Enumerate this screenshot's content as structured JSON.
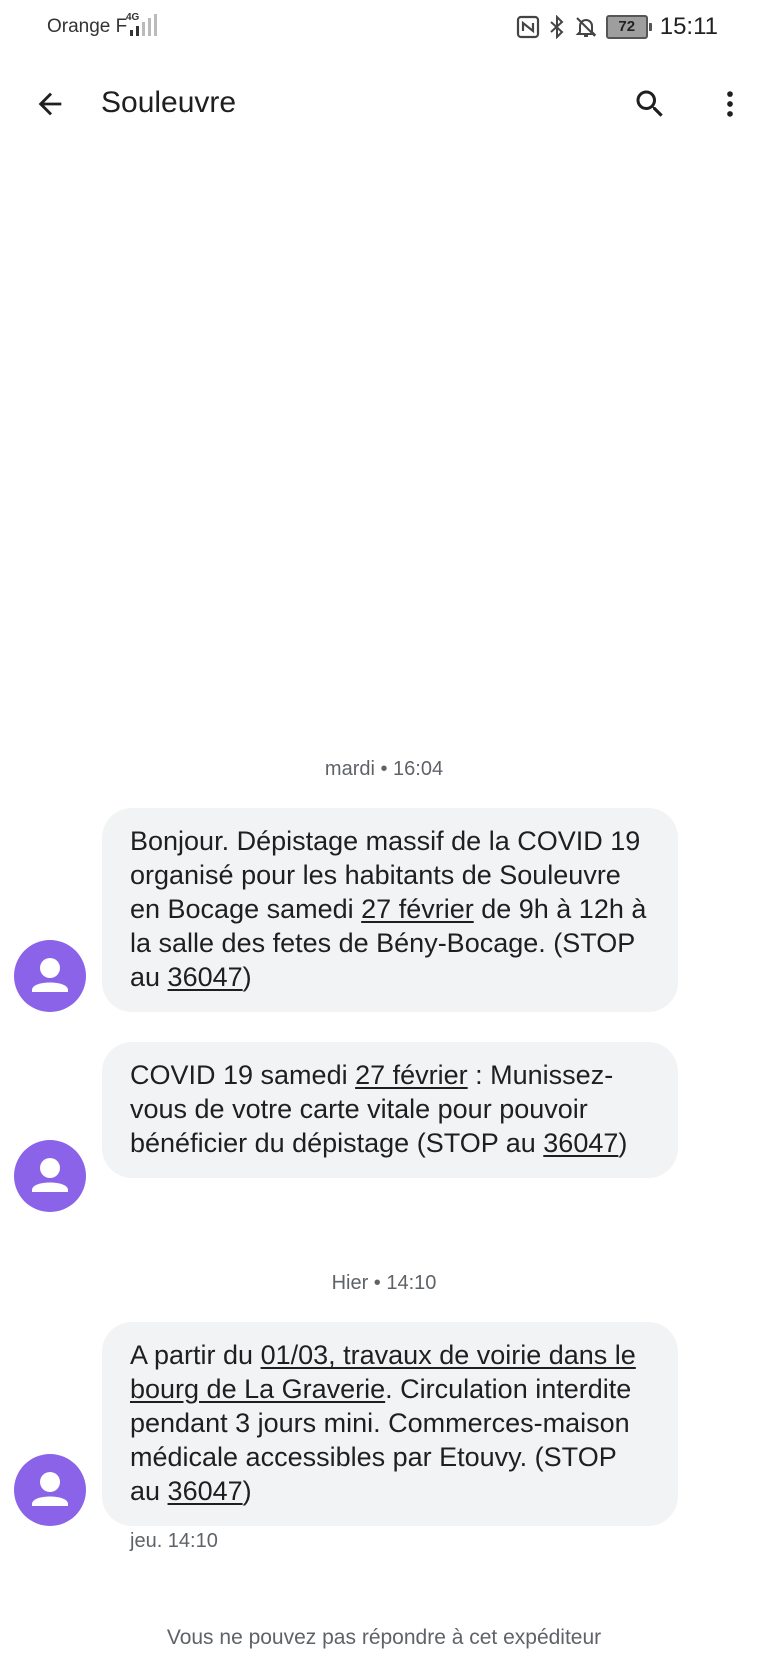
{
  "status_bar": {
    "carrier": "Orange F",
    "network": "4G",
    "battery": "72",
    "time": "15:11"
  },
  "app_bar": {
    "title": "Souleuvre",
    "icons": [
      "back-arrow-icon",
      "search-icon",
      "more-vert-icon"
    ]
  },
  "conversation": {
    "groups": [
      {
        "timestamp": "mardi • 16:04",
        "messages": [
          {
            "parts": [
              {
                "t": "Bonjour. Dépistage massif de la COVID 19 organisé pour les habitants de Souleuvre en Bocage samedi "
              },
              {
                "t": "27 février",
                "link": true
              },
              {
                "t": " de 9h à 12h à la salle des fetes de Bény-Bocage. (STOP au "
              },
              {
                "t": "36047",
                "link": true
              },
              {
                "t": ")"
              }
            ]
          },
          {
            "parts": [
              {
                "t": "COVID 19 samedi "
              },
              {
                "t": "27 février",
                "link": true
              },
              {
                "t": " : Munissez-vous de votre carte vitale pour pouvoir bénéficier du dépistage (STOP au "
              },
              {
                "t": "36047",
                "link": true
              },
              {
                "t": ")"
              }
            ]
          }
        ]
      },
      {
        "timestamp": "Hier  • 14:10",
        "messages": [
          {
            "parts": [
              {
                "t": "A partir du "
              },
              {
                "t": "01/03, travaux de voirie dans le bourg de La Graverie",
                "link": true
              },
              {
                "t": ". Circulation interdite pendant 3 jours mini. Commerces-maison médicale accessibles par Etouvy. (STOP au "
              },
              {
                "t": "36047",
                "link": true
              },
              {
                "t": ")"
              }
            ],
            "sent_time": "jeu. 14:10"
          }
        ]
      }
    ]
  },
  "footer": {
    "note": "Vous ne pouvez pas répondre à cet expéditeur"
  },
  "colors": {
    "avatar": "#8a63e8",
    "bubble": "#f1f3f4",
    "secondary_text": "#5f6368"
  }
}
